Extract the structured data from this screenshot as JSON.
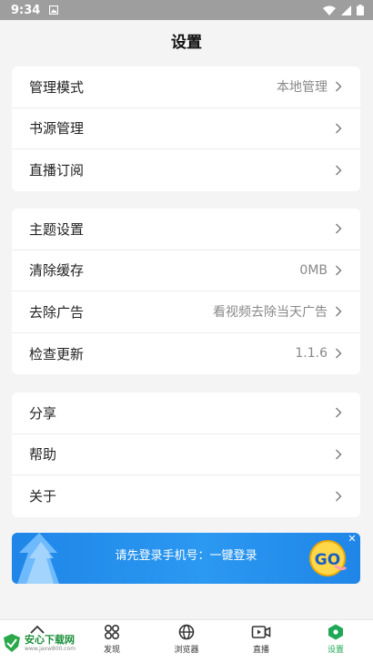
{
  "status_bar": {
    "time": "9:34"
  },
  "header": {
    "title": "设置"
  },
  "groups": [
    {
      "items": [
        {
          "label": "管理模式",
          "value": "本地管理"
        },
        {
          "label": "书源管理",
          "value": ""
        },
        {
          "label": "直播订阅",
          "value": ""
        }
      ]
    },
    {
      "items": [
        {
          "label": "主题设置",
          "value": ""
        },
        {
          "label": "清除缓存",
          "value": "0MB"
        },
        {
          "label": "去除广告",
          "value": "看视频去除当天广告"
        },
        {
          "label": "检查更新",
          "value": "1.1.6"
        }
      ]
    },
    {
      "items": [
        {
          "label": "分享",
          "value": ""
        },
        {
          "label": "帮助",
          "value": ""
        },
        {
          "label": "关于",
          "value": ""
        }
      ]
    }
  ],
  "ad": {
    "text": "请先登录手机号：一键登录",
    "go": "GO"
  },
  "bottom_nav": [
    {
      "label": "",
      "icon": "home-icon"
    },
    {
      "label": "发现",
      "icon": "discover-icon"
    },
    {
      "label": "浏览器",
      "icon": "globe-icon"
    },
    {
      "label": "直播",
      "icon": "video-icon"
    },
    {
      "label": "设置",
      "icon": "settings-icon",
      "active": true
    }
  ],
  "watermark": {
    "main": "安心下载网",
    "sub": "www.jaxw800.com"
  },
  "colors": {
    "accent": "#1fa855",
    "ad_blue": "#2b98f1",
    "background": "#f4f4f4"
  }
}
